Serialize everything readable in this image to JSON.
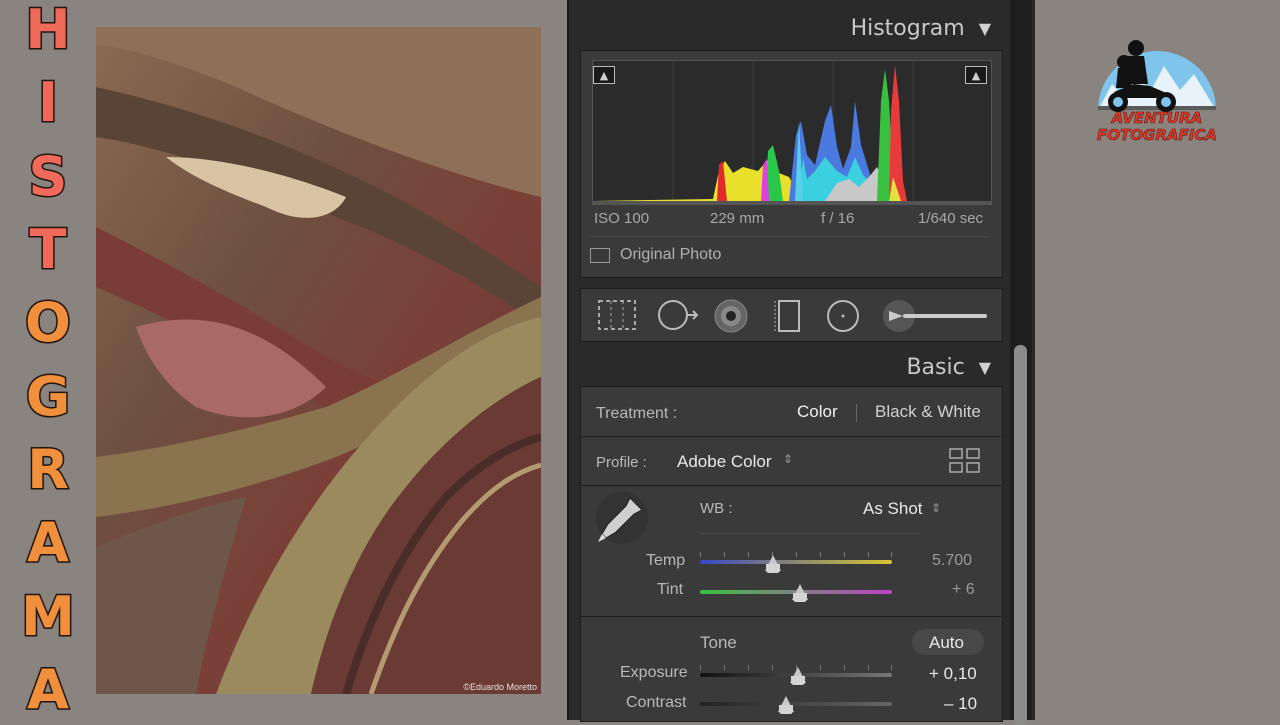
{
  "title_letters": [
    "H",
    "I",
    "S",
    "T",
    "O",
    "G",
    "R",
    "A",
    "M",
    "A"
  ],
  "photo": {
    "credit": "©Eduardo Moretto"
  },
  "histogram": {
    "header": "Histogram",
    "iso": "ISO 100",
    "focal": "229 mm",
    "aperture": "f / 16",
    "shutter": "1/640 sec",
    "original_photo": "Original Photo"
  },
  "basic": {
    "header": "Basic",
    "treatment_label": "Treatment :",
    "color_option": "Color",
    "bw_option": "Black & White",
    "profile_label": "Profile :",
    "profile_value": "Adobe Color",
    "wb_label": "WB :",
    "wb_value": "As Shot",
    "temp_label": "Temp",
    "temp_value": "5.700",
    "temp_position": 0.38,
    "tint_label": "Tint",
    "tint_value": "+ 6",
    "tint_position": 0.52,
    "tone_label": "Tone",
    "auto_label": "Auto",
    "exposure_label": "Exposure",
    "exposure_value": "+ 0,10",
    "exposure_position": 0.51,
    "contrast_label": "Contrast",
    "contrast_value": "– 10",
    "contrast_position": 0.45
  },
  "logo": {
    "line1": "AVENTURA",
    "line2": "FOTOGRAFICA"
  },
  "colors": {
    "background": "#8a8480",
    "panel": "#2a2a2a",
    "title_red": "#f06a5c",
    "title_orange": "#f0903c",
    "logo_red": "#e23a28"
  }
}
